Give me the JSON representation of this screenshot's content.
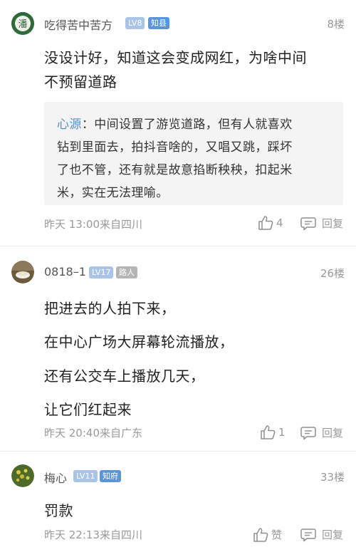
{
  "comments": [
    {
      "username": "吃得苦中苦方",
      "level": "LV8",
      "title": "知县",
      "floor": "8楼",
      "lines": [
        "没设计好，知道这会变成网红，为啥中间",
        "不预留道路"
      ],
      "quote": {
        "author": "心源",
        "first_line_rest": "：中间设置了游览道路，但有人就喜欢",
        "lines": [
          "钻到里面去，拍抖音啥的，又唱又跳，踩坏",
          "了也不管，还有就是故意掐断秧秧，扣起米",
          "米，实在无法理喻。"
        ]
      },
      "meta": "昨天 13:00来自四川",
      "likes": "4",
      "reply_label": "回复"
    },
    {
      "username": "0818–1",
      "level": "LV17",
      "title": "路人",
      "floor": "26楼",
      "lines": [
        "把进去的人拍下来，",
        "在中心广场大屏幕轮流播放，",
        "还有公交车上播放几天，",
        "让它们红起来"
      ],
      "meta": "昨天 20:40来自广东",
      "likes": "1",
      "reply_label": "回复"
    },
    {
      "username": "梅心",
      "level": "LV11",
      "title": "知府",
      "floor": "33楼",
      "lines": [
        "罚款"
      ],
      "meta": "昨天 22:13来自四川",
      "likes": "赞",
      "reply_label": "回复"
    }
  ],
  "colors": {
    "level_badge": "#a9c4e6",
    "title_badge_blue": "#5c94d6",
    "title_badge_gray": "#b5b5b5",
    "quote_author": "#5b8ec8",
    "meta_text": "#9a9a9a"
  },
  "icons": {
    "like": "thumbs-up-icon",
    "reply": "comment-icon"
  }
}
